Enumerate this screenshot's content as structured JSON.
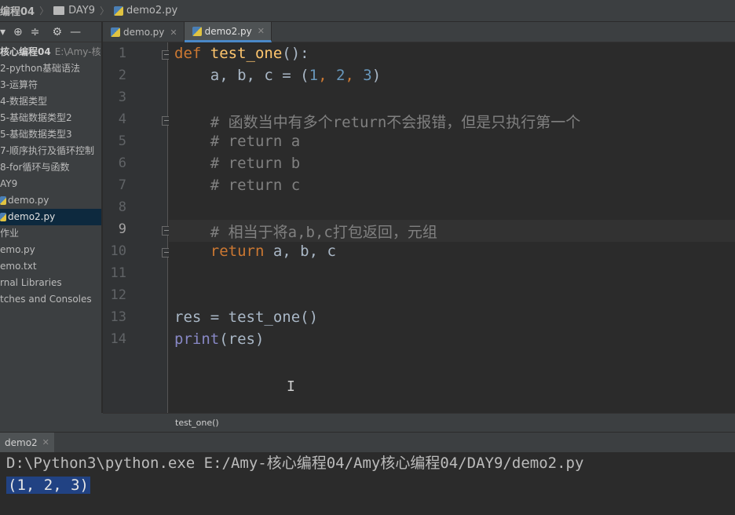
{
  "breadcrumb": {
    "project": "编程04",
    "folder": "DAY9",
    "file": "demo2.py"
  },
  "sidebar": {
    "toolbar_icons": [
      "settings-dropdown-icon",
      "target-icon",
      "collapse-icon",
      "gear-icon",
      "minimize-icon"
    ],
    "root": {
      "label": "核心编程04",
      "path": "E:\\Amy-核心"
    },
    "items": [
      {
        "label": "2-python基础语法"
      },
      {
        "label": "3-运算符"
      },
      {
        "label": "4-数据类型"
      },
      {
        "label": "5-基础数据类型2"
      },
      {
        "label": "5-基础数据类型3"
      },
      {
        "label": "7-顺序执行及循环控制"
      },
      {
        "label": "8-for循环与函数"
      },
      {
        "label": "AY9"
      },
      {
        "label": "demo.py"
      },
      {
        "label": "demo2.py"
      },
      {
        "label": "作业"
      },
      {
        "label": "emo.py"
      },
      {
        "label": "emo.txt"
      },
      {
        "label": "rnal Libraries"
      },
      {
        "label": "tches and Consoles"
      }
    ]
  },
  "tabs": [
    {
      "label": "demo.py",
      "active": false
    },
    {
      "label": "demo2.py",
      "active": true
    }
  ],
  "editor": {
    "line_numbers": [
      "1",
      "2",
      "3",
      "4",
      "5",
      "6",
      "7",
      "8",
      "9",
      "10",
      "11",
      "12",
      "13",
      "14"
    ],
    "current_line": "9",
    "lines": {
      "l1_kw": "def",
      "l1_fn": "test_one",
      "l1_rest": "():",
      "l2_a": "a, b, c = (",
      "l2_n1": "1",
      "l2_c1": ", ",
      "l2_n2": "2",
      "l2_c2": ", ",
      "l2_n3": "3",
      "l2_end": ")",
      "l4": "# 函数当中有多个return不会报错，但是只执行第一个",
      "l5": "# return a",
      "l6": "# return b",
      "l7": "# return c",
      "l9": "# 相当于将a,b,c打包返回，元组",
      "l10_kw": "return",
      "l10_rest": " a, b, c",
      "l13": "res = test_one()",
      "l14_bi": "print",
      "l14_rest": "(res)"
    },
    "crumb": "test_one()"
  },
  "run": {
    "tab_label": "demo2",
    "command": "D:\\Python3\\python.exe E:/Amy-核心编程04/Amy核心编程04/DAY9/demo2.py",
    "output": "(1, 2, 3)"
  },
  "colors": {
    "keyword": "#cc7832",
    "function": "#ffc66d",
    "number": "#6897bb",
    "comment": "#808080",
    "builtin": "#8888c6",
    "selection": "#214283"
  }
}
